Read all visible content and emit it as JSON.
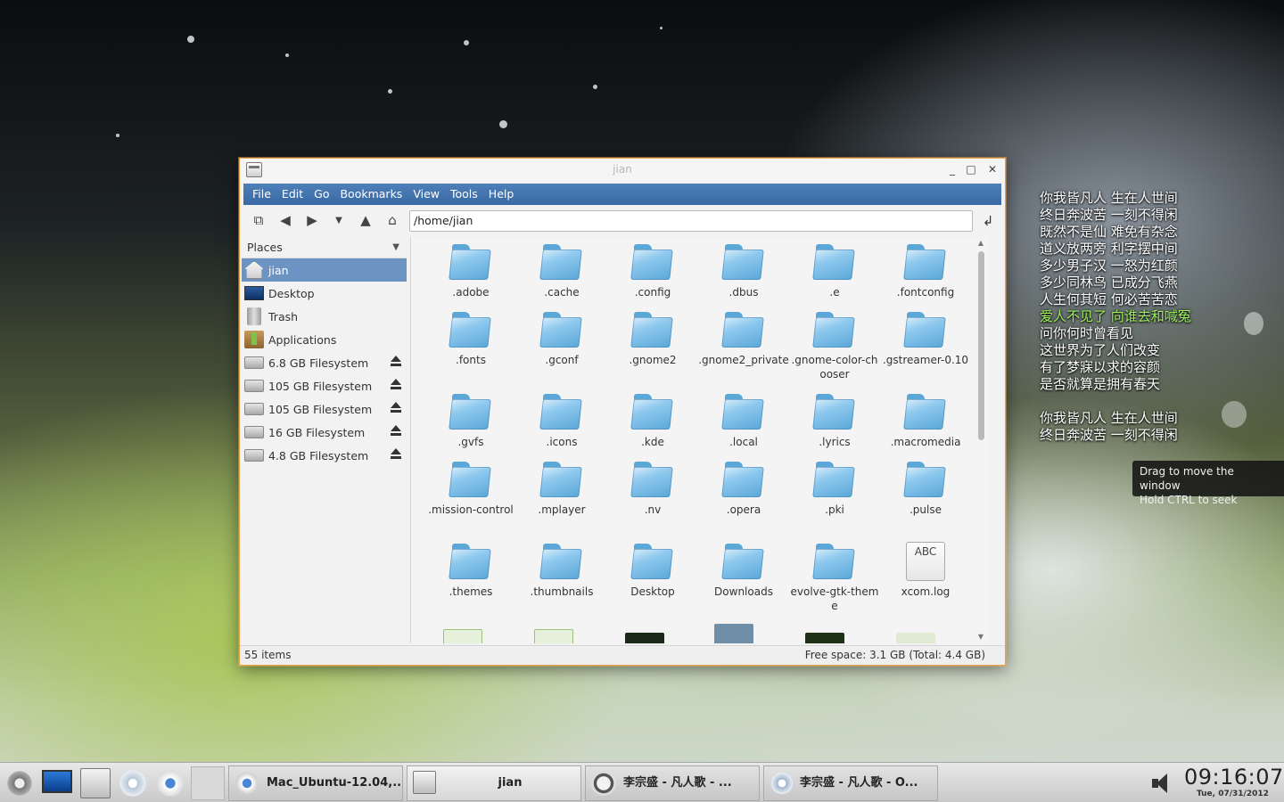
{
  "window": {
    "title": "jian",
    "menu": [
      "File",
      "Edit",
      "Go",
      "Bookmarks",
      "View",
      "Tools",
      "Help"
    ],
    "address": "/home/jian",
    "places_title": "Places",
    "places": [
      {
        "label": "jian",
        "icon": "home-icon",
        "selected": true
      },
      {
        "label": "Desktop",
        "icon": "desktop-icon"
      },
      {
        "label": "Trash",
        "icon": "trash-icon"
      },
      {
        "label": "Applications",
        "icon": "applications-icon"
      },
      {
        "label": "6.8 GB Filesystem",
        "icon": "drive-icon",
        "eject": true
      },
      {
        "label": "105 GB Filesystem",
        "icon": "drive-icon",
        "eject": true
      },
      {
        "label": "105 GB Filesystem",
        "icon": "drive-icon",
        "eject": true
      },
      {
        "label": "16 GB Filesystem",
        "icon": "drive-icon",
        "eject": true
      },
      {
        "label": "4.8 GB Filesystem",
        "icon": "drive-icon",
        "eject": true
      }
    ],
    "files": [
      {
        "name": ".adobe",
        "icon": "folder-icon"
      },
      {
        "name": ".cache",
        "icon": "folder-icon"
      },
      {
        "name": ".config",
        "icon": "folder-icon"
      },
      {
        "name": ".dbus",
        "icon": "folder-icon"
      },
      {
        "name": ".e",
        "icon": "folder-icon"
      },
      {
        "name": ".fontconfig",
        "icon": "folder-icon"
      },
      {
        "name": ".fonts",
        "icon": "folder-icon"
      },
      {
        "name": ".gconf",
        "icon": "folder-icon"
      },
      {
        "name": ".gnome2",
        "icon": "folder-icon"
      },
      {
        "name": ".gnome2_private",
        "icon": "folder-icon"
      },
      {
        "name": ".gnome-color-chooser",
        "icon": "folder-icon"
      },
      {
        "name": ".gstreamer-0.10",
        "icon": "folder-icon"
      },
      {
        "name": ".gvfs",
        "icon": "folder-icon"
      },
      {
        "name": ".icons",
        "icon": "folder-icon"
      },
      {
        "name": ".kde",
        "icon": "folder-icon"
      },
      {
        "name": ".local",
        "icon": "folder-icon"
      },
      {
        "name": ".lyrics",
        "icon": "folder-icon"
      },
      {
        "name": ".macromedia",
        "icon": "folder-icon"
      },
      {
        "name": ".mission-control",
        "icon": "folder-icon"
      },
      {
        "name": ".mplayer",
        "icon": "folder-icon"
      },
      {
        "name": ".nv",
        "icon": "folder-icon"
      },
      {
        "name": ".opera",
        "icon": "folder-icon"
      },
      {
        "name": ".pki",
        "icon": "folder-icon"
      },
      {
        "name": ".pulse",
        "icon": "folder-icon"
      },
      {
        "name": ".themes",
        "icon": "folder-icon"
      },
      {
        "name": ".thumbnails",
        "icon": "folder-icon"
      },
      {
        "name": "Desktop",
        "icon": "folder-icon"
      },
      {
        "name": "Downloads",
        "icon": "folder-icon"
      },
      {
        "name": "evolve-gtk-theme",
        "icon": "folder-icon"
      },
      {
        "name": "xcom.log",
        "icon": "text-file-icon",
        "badge": "ABC"
      }
    ],
    "status_left": "55 items",
    "status_right": "Free space: 3.1 GB (Total: 4.4 GB)"
  },
  "lyrics": {
    "lines": [
      "你我皆凡人 生在人世间",
      "终日奔波苦 一刻不得闲",
      "既然不是仙 难免有杂念",
      "道义放两旁 利字摆中间",
      "多少男子汉 一怒为红颜",
      "多少同林鸟 已成分飞燕",
      "人生何其短 何必苦苦恋",
      "爱人不见了 向谁去和喊冤",
      "问你何时曾看见",
      "这世界为了人们改变",
      "有了梦寐以求的容颜",
      "是否就算是拥有春天"
    ],
    "lines2": [
      "你我皆凡人 生在人世间",
      "终日奔波苦 一刻不得闲"
    ],
    "current_index": 7,
    "current_color": "#9cf05a"
  },
  "tooltip": {
    "line1": "Drag to move the window",
    "line2": "Hold CTRL to seek"
  },
  "taskbar": {
    "tasks": [
      {
        "label": "Mac_Ubuntu-12.04,...",
        "icon": "chrome-icon"
      },
      {
        "label": "jian",
        "icon": "file-manager-icon"
      },
      {
        "label": "李宗盛 - 凡人歌 - ...",
        "icon": "player-icon"
      },
      {
        "label": "李宗盛 - 凡人歌 - O...",
        "icon": "music-icon"
      }
    ],
    "clock": "09:16:07",
    "date": "Tue, 07/31/2012"
  },
  "colors": {
    "menubar": "#3f6fab",
    "selection": "#6d93c2",
    "window_border": "#e8a24a"
  }
}
